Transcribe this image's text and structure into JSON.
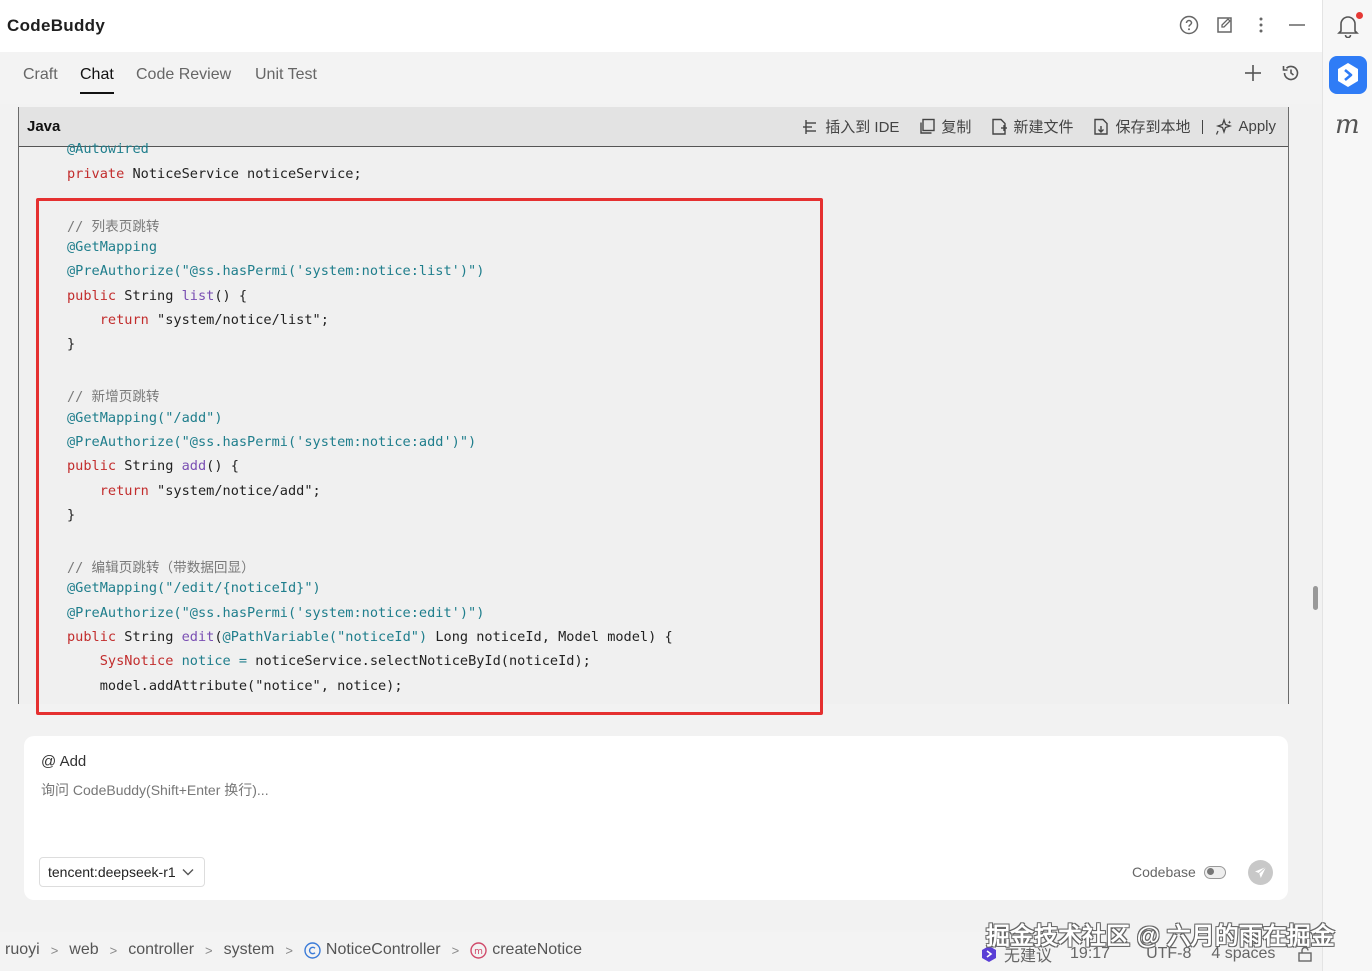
{
  "app": {
    "title": "CodeBuddy"
  },
  "tabs": [
    {
      "label": "Craft",
      "active": false
    },
    {
      "label": "Chat",
      "active": true
    },
    {
      "label": "Code Review",
      "active": false
    },
    {
      "label": "Unit Test",
      "active": false
    }
  ],
  "code_block": {
    "language": "Java",
    "actions": {
      "insert_ide": "插入到 IDE",
      "copy": "复制",
      "new_file": "新建文件",
      "save_local": "保存到本地",
      "apply": "Apply"
    }
  },
  "chat": {
    "mention_label": "@ Add",
    "placeholder": "询问 CodeBuddy(Shift+Enter 换行)...",
    "model": "tencent:deepseek-r1",
    "codebase_label": "Codebase"
  },
  "breadcrumb": [
    "ruoyi",
    "web",
    "controller",
    "system",
    "NoticeController",
    "createNotice"
  ],
  "status": {
    "suggestion": "无建议",
    "time": "19:17",
    "encoding": "UTF-8",
    "indent": "4 spaces"
  },
  "watermark": "掘金技术社区 @ 六月的雨在掘金",
  "colors": {
    "accent": "#2f7cf6",
    "highlight_border": "#e53030"
  }
}
